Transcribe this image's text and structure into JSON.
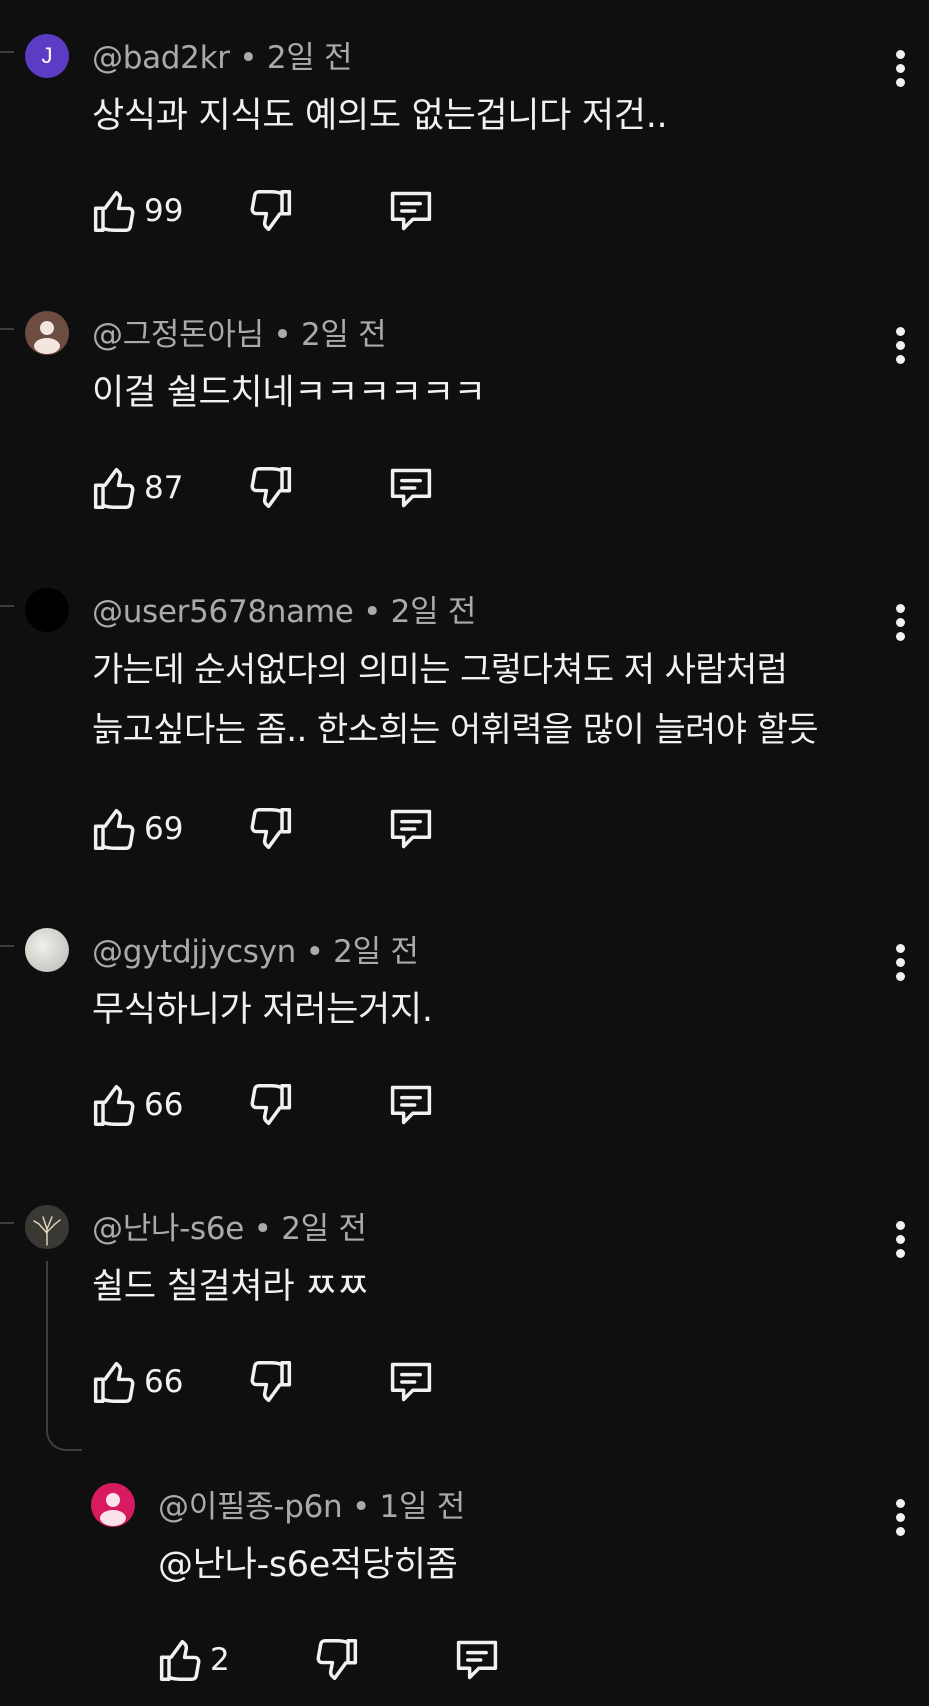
{
  "comments": [
    {
      "author": "@bad2kr",
      "time": "2일 전",
      "text": "상식과 지식도 예의도 없는겁니다 저건..",
      "likes": "99",
      "avatar_letter": "J",
      "avatar_color": "#5b3cc4"
    },
    {
      "author": "@그정돈아님",
      "time": "2일 전",
      "text": "이걸 쉴드치네ㅋㅋㅋㅋㅋㅋ",
      "likes": "87",
      "avatar_color": "#6d4c41"
    },
    {
      "author": "@user5678name",
      "time": "2일 전",
      "text": "가는데 순서없다의 의미는 그렇다쳐도 저 사람처럼\n늙고싶다는 좀.. 한소희는 어휘력을 많이 늘려야 할듯",
      "likes": "69",
      "avatar_color": "#000000"
    },
    {
      "author": "@gytdjjycsyn",
      "time": "2일 전",
      "text": "무식하니가 저러는거지.",
      "likes": "66",
      "avatar_color": "#d9d9d4"
    },
    {
      "author": "@난나-s6e",
      "time": "2일 전",
      "text": "쉴드 칠걸쳐라 ㅉㅉ",
      "likes": "66",
      "avatar_color": "#2b2a28"
    }
  ],
  "reply": {
    "author": "@이필종-p6n",
    "time": "1일 전",
    "text": "@난나-s6e적당히좀",
    "likes": "2",
    "avatar_color": "#d81b60"
  },
  "separator": "•"
}
